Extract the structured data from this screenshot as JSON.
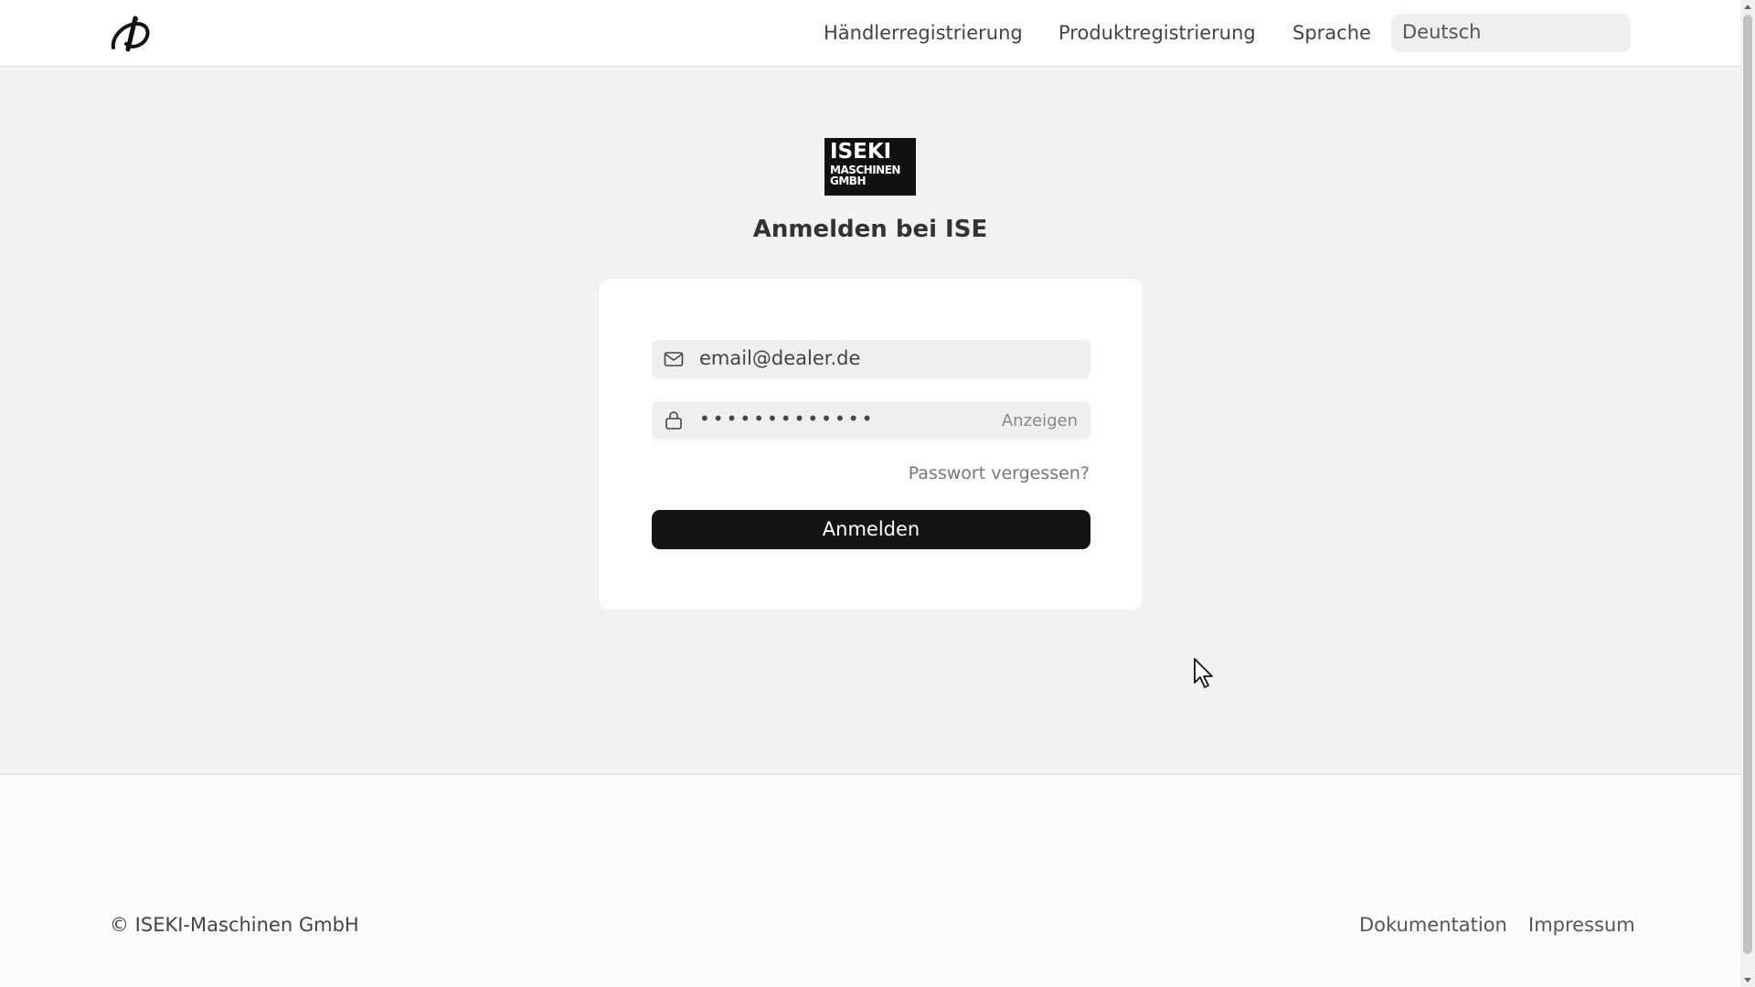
{
  "header": {
    "brand_icon": "brand-swirl-icon",
    "nav": {
      "dealer_registration": "Händlerregistrierung",
      "product_registration": "Produktregistrierung",
      "language_label": "Sprache"
    },
    "language_select": {
      "value": "Deutsch"
    }
  },
  "main": {
    "logo": {
      "line1": "ISEKI",
      "line2": "MASCHINEN",
      "line3": "GMBH"
    },
    "title": "Anmelden bei ISE",
    "form": {
      "email": {
        "icon": "mail-icon",
        "value": "email@dealer.de"
      },
      "password": {
        "icon": "lock-icon",
        "masked_value": "•••••••••••••",
        "show_label": "Anzeigen"
      },
      "forgot_password": "Passwort vergessen?",
      "submit_label": "Anmelden"
    }
  },
  "footer": {
    "copyright": "© ISEKI-Maschinen GmbH",
    "links": {
      "documentation": "Dokumentation",
      "imprint": "Impressum"
    }
  },
  "colors": {
    "page_bg": "#f3f3f3",
    "button_bg": "#141414",
    "input_bg": "#efefef"
  }
}
